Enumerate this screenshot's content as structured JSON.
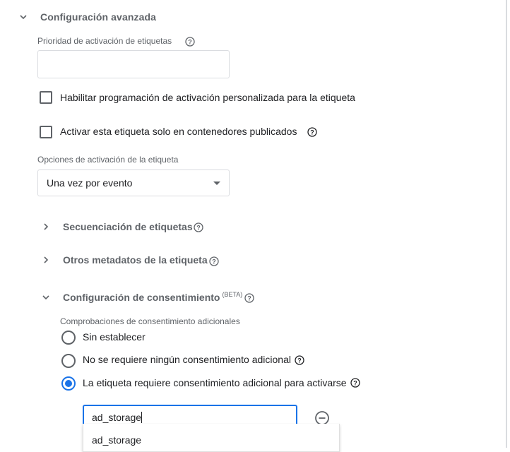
{
  "advanced": {
    "title": "Configuración avanzada",
    "priority_label": "Prioridad de activación de etiquetas",
    "priority_value": "",
    "custom_schedule_label": "Habilitar programación de activación personalizada para la etiqueta",
    "published_only_label": "Activar esta etiqueta solo en contenedores publicados",
    "firing_options_label": "Opciones de activación de la etiqueta",
    "firing_options_value": "Una vez por evento"
  },
  "subsections": {
    "sequencing": "Secuenciación de etiquetas",
    "metadata": "Otros metadatos de la etiqueta",
    "consent": "Configuración de consentimiento",
    "consent_badge": "(BETA)"
  },
  "consent": {
    "checks_label": "Comprobaciones de consentimiento adicionales",
    "options": [
      "Sin establecer",
      "No se requiere ningún consentimiento adicional",
      "La etiqueta requiere consentimiento adicional para activarse"
    ],
    "selected_index": 2,
    "input_value": "ad_storage",
    "suggestions": [
      "ad_storage"
    ]
  },
  "colors": {
    "accent": "#1a73e8",
    "secondary_text": "#5f6368",
    "primary_text": "#202124",
    "border": "#dadce0"
  }
}
